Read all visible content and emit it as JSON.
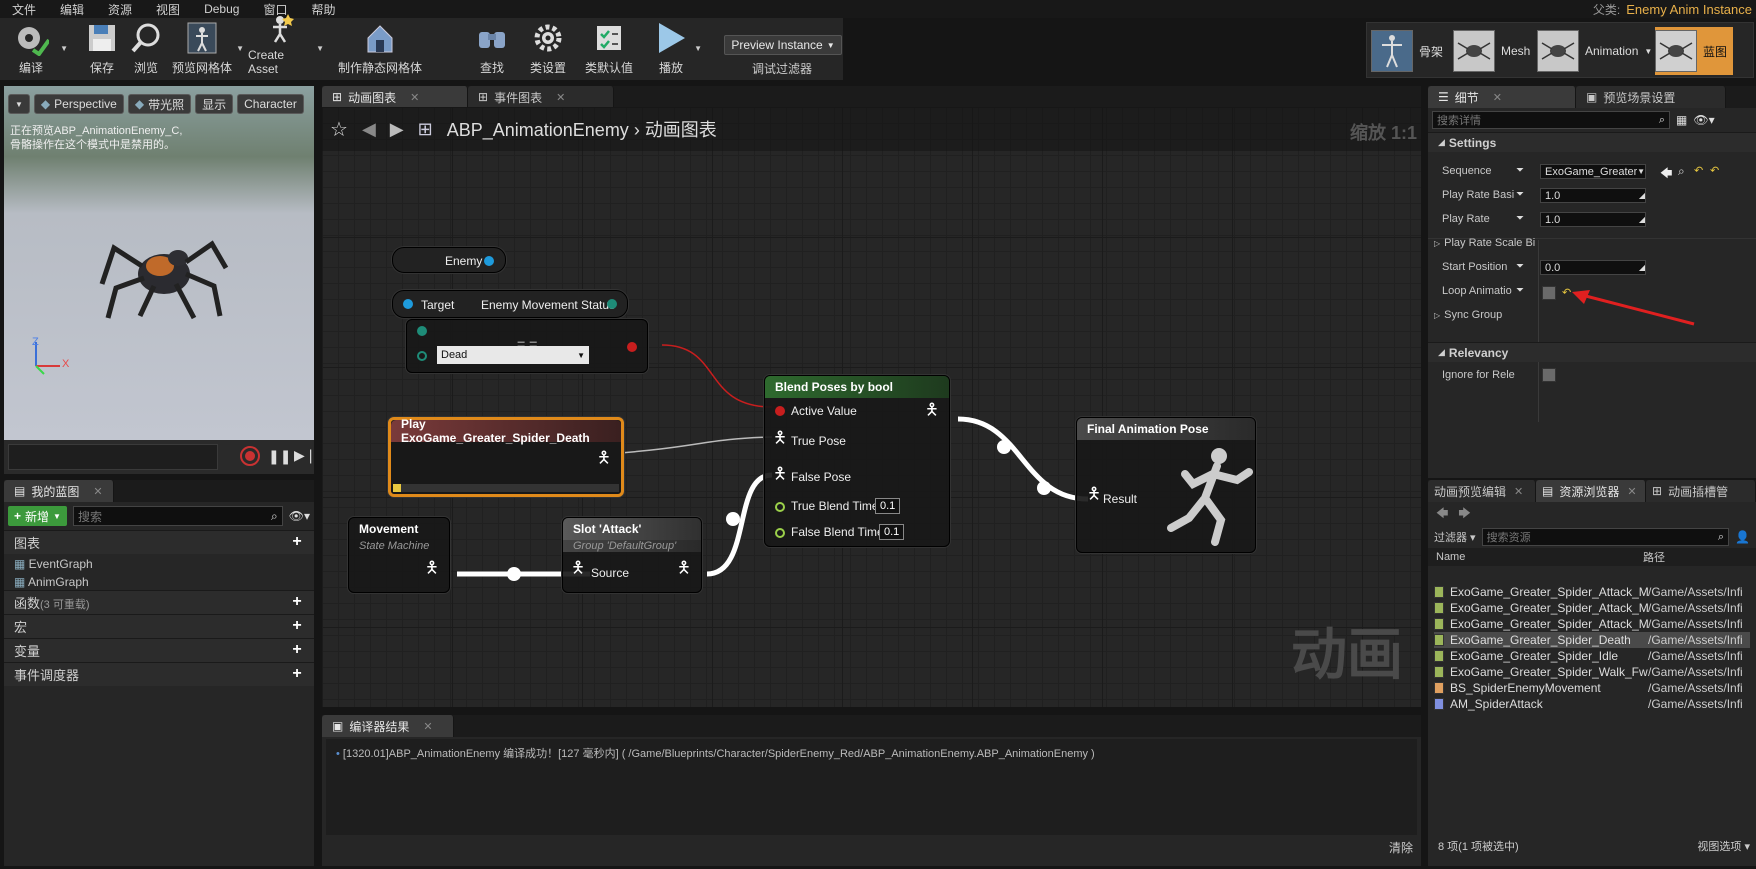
{
  "menu": [
    "文件",
    "编辑",
    "资源",
    "视图",
    "Debug",
    "窗口",
    "帮助"
  ],
  "parent_class": {
    "label": "父类:",
    "value": "Enemy Anim Instance"
  },
  "toolbar": {
    "compile": "编译",
    "save": "保存",
    "browse": "浏览",
    "preview_mesh": "预览网格体",
    "create_asset": "Create Asset",
    "make_static_mesh": "制作静态网格体",
    "find": "查找",
    "class_settings": "类设置",
    "class_defaults": "类默认值",
    "play": "播放",
    "preview_instance": "Preview Instance",
    "debug_filter": "调试过滤器"
  },
  "modes": {
    "skeleton": "骨架",
    "mesh": "Mesh",
    "animation": "Animation",
    "blueprint": "蓝图"
  },
  "viewport": {
    "perspective": "Perspective",
    "lit": "带光照",
    "show": "显示",
    "character": "Character",
    "note_line1": "正在预览ABP_AnimationEnemy_C,",
    "note_line2": "骨骼操作在这个模式中是禁用的。",
    "axis_z": "Z",
    "axis_x": "X"
  },
  "my_blueprint": {
    "tab": "我的蓝图",
    "add_new": "新增",
    "search_placeholder": "搜索",
    "graphs_label": "图表",
    "graphs": [
      "EventGraph",
      "AnimGraph"
    ],
    "functions_label": "函数",
    "functions_note": "(3 可重载)",
    "macros_label": "宏",
    "variables_label": "变量",
    "dispatchers_label": "事件调度器"
  },
  "graph_tabs": [
    "动画图表",
    "事件图表"
  ],
  "breadcrumb": {
    "root": "ABP_AnimationEnemy",
    "current": "动画图表",
    "zoom": "缩放 1:1"
  },
  "watermark": "动画",
  "nodes": {
    "enemy_var": "Enemy",
    "get_status": {
      "target": "Target",
      "output": "Enemy Movement Status"
    },
    "equal": {
      "symbol": "= =",
      "enum_value": "Dead"
    },
    "play_seq": {
      "title": "Play ExoGame_Greater_Spider_Death"
    },
    "movement": {
      "title": "Movement",
      "subtitle": "State Machine"
    },
    "slot": {
      "title": "Slot 'Attack'",
      "subtitle": "Group 'DefaultGroup'",
      "pin": "Source"
    },
    "blend": {
      "title": "Blend Poses by bool",
      "active": "Active Value",
      "true_pose": "True Pose",
      "false_pose": "False Pose",
      "true_time_label": "True Blend Time",
      "true_time": "0.1",
      "false_time_label": "False Blend Time",
      "false_time": "0.1"
    },
    "final": {
      "title": "Final Animation Pose",
      "result": "Result"
    }
  },
  "compiler": {
    "tab": "编译器结果",
    "message": "[1320.01]ABP_AnimationEnemy 编译成功！[127 毫秒内] ( /Game/Blueprints/Character/SpiderEnemy_Red/ABP_AnimationEnemy.ABP_AnimationEnemy )",
    "clear": "清除"
  },
  "details": {
    "tab": "细节",
    "tab2": "预览场景设置",
    "search_placeholder": "搜索详情",
    "settings_section": "Settings",
    "sequence_label": "Sequence",
    "sequence_value": "ExoGame_Greater_",
    "play_rate_basis_label": "Play Rate Basi",
    "play_rate_basis_value": "1.0",
    "play_rate_label": "Play Rate",
    "play_rate_value": "1.0",
    "play_rate_scale_label": "Play Rate Scale Bi",
    "start_position_label": "Start Position",
    "start_position_value": "0.0",
    "loop_label": "Loop Animatio",
    "sync_group_label": "Sync Group",
    "relevancy_section": "Relevancy",
    "ignore_label": "Ignore for Rele"
  },
  "asset_browser": {
    "tabs": [
      "动画预览编辑",
      "资源浏览器",
      "动画插槽管"
    ],
    "filter": "过滤器",
    "search_placeholder": "搜索资源",
    "col_name": "Name",
    "col_path": "路径",
    "items": [
      {
        "name": "ExoGame_Greater_Spider_Attack_M",
        "path": "/Game/Assets/Infi"
      },
      {
        "name": "ExoGame_Greater_Spider_Attack_M",
        "path": "/Game/Assets/Infi"
      },
      {
        "name": "ExoGame_Greater_Spider_Attack_M",
        "path": "/Game/Assets/Infi"
      },
      {
        "name": "ExoGame_Greater_Spider_Death",
        "path": "/Game/Assets/Infi"
      },
      {
        "name": "ExoGame_Greater_Spider_Idle",
        "path": "/Game/Assets/Infi"
      },
      {
        "name": "ExoGame_Greater_Spider_Walk_Fw",
        "path": "/Game/Assets/Infi"
      },
      {
        "name": "BS_SpiderEnemyMovement",
        "path": "/Game/Assets/Infi"
      },
      {
        "name": "AM_SpiderAttack",
        "path": "/Game/Assets/Infi"
      }
    ],
    "status": "8 项(1 项被选中)",
    "view_options": "视图选项"
  },
  "colors": {
    "accent": "#e0963a",
    "exec_red": "#c81e1e",
    "blue_pin": "#1e9bdc",
    "teal_pin": "#1e8c78"
  }
}
